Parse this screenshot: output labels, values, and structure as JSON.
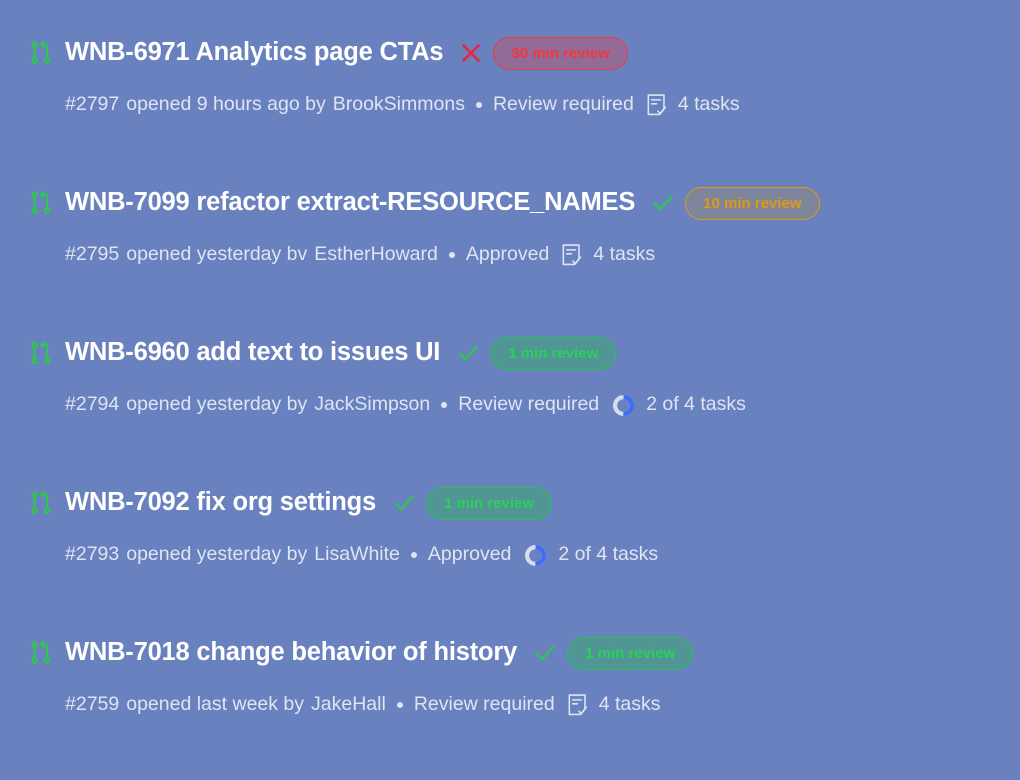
{
  "background_color": "#6981bf",
  "accent_colors": {
    "branch_icon": "#2fc64f",
    "approved_check": "#2fc64f",
    "rejected_x": "#e8253a",
    "badge_red": "#f2373f",
    "badge_amber": "#dc9a18",
    "badge_green": "#27c254",
    "progress_ring": "#3b6ef5",
    "title_text": "#ffffff",
    "meta_text": "#dfe4f2"
  },
  "pull_requests": [
    {
      "branch_icon": "pull-request-icon",
      "title": "WNB-6971 Analytics page CTAs",
      "status_icon": "x-mark-icon",
      "status": "rejected",
      "review_badge": {
        "label": "30 min review",
        "style": "red"
      },
      "number": "#2797",
      "opened": "opened 9 hours ago by",
      "author": "BrookSimmons",
      "review_state": "Review required",
      "tasks_icon": "task-list-icon",
      "tasks": "4 tasks"
    },
    {
      "branch_icon": "pull-request-icon",
      "title": "WNB-7099 refactor extract-RESOURCE_NAMES",
      "status_icon": "check-mark-icon",
      "status": "approved",
      "review_badge": {
        "label": "10 min review",
        "style": "amber"
      },
      "number": "#2795",
      "opened": "opened yesterday bv",
      "author": "EstherHoward",
      "review_state": "Approved",
      "tasks_icon": "task-list-icon",
      "tasks": "4 tasks"
    },
    {
      "branch_icon": "pull-request-icon",
      "title": "WNB-6960 add text to issues UI",
      "status_icon": "check-mark-icon",
      "status": "approved",
      "review_badge": {
        "label": "1 min review",
        "style": "green"
      },
      "number": "#2794",
      "opened": "opened yesterday by",
      "author": "JackSimpson",
      "review_state": "Review required",
      "tasks_icon": "progress-ring-icon",
      "tasks": "2 of 4 tasks",
      "progress_percent": 50
    },
    {
      "branch_icon": "pull-request-icon",
      "title": "WNB-7092 fix org settings",
      "status_icon": "check-mark-icon",
      "status": "approved",
      "review_badge": {
        "label": "1 min review",
        "style": "green"
      },
      "number": "#2793",
      "opened": "opened yesterday by",
      "author": "LisaWhite",
      "review_state": "Approved",
      "tasks_icon": "progress-ring-icon",
      "tasks": "2 of 4 tasks",
      "progress_percent": 50
    },
    {
      "branch_icon": "pull-request-icon",
      "title": "WNB-7018 change behavior of history",
      "status_icon": "check-mark-icon",
      "status": "approved",
      "review_badge": {
        "label": "1 min review",
        "style": "green"
      },
      "number": "#2759",
      "opened": "opened last week by",
      "author": "JakeHall",
      "review_state": "Review required",
      "tasks_icon": "task-list-icon",
      "tasks": "4 tasks"
    }
  ]
}
